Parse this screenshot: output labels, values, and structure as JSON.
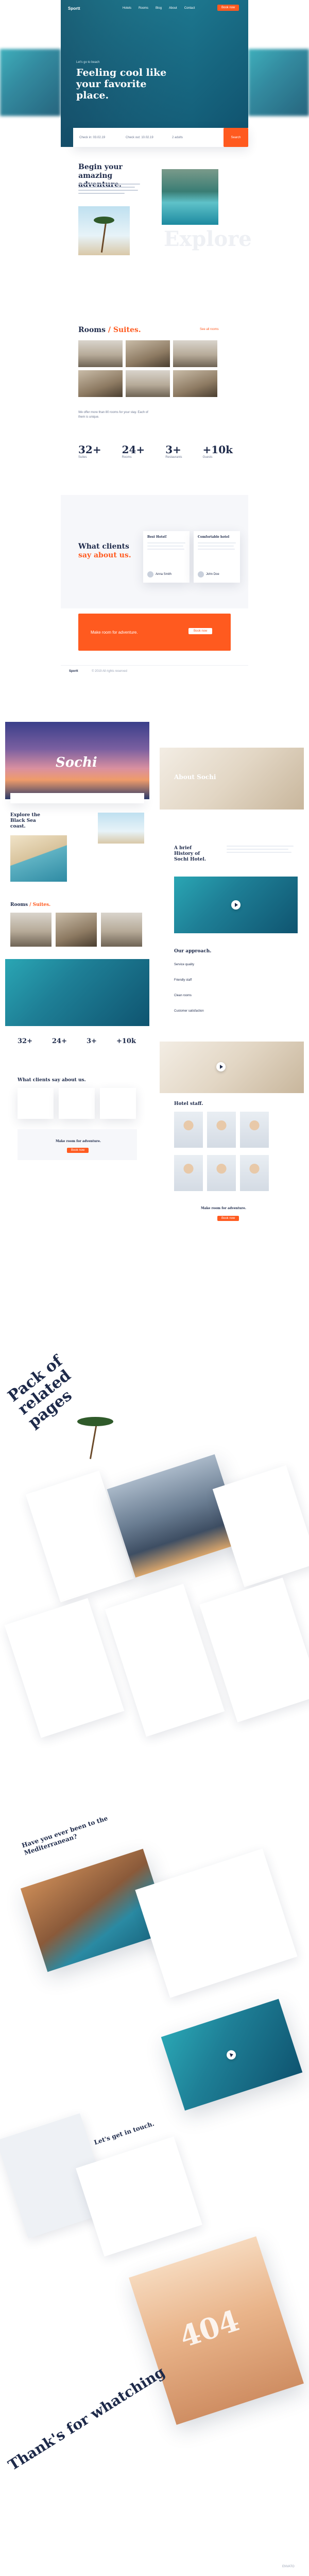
{
  "hero": {
    "logo": "Sportt",
    "nav": [
      "Hotels",
      "Rooms",
      "Blog",
      "About",
      "Contact"
    ],
    "cta": "Book now",
    "kicker": "Let's go to beach",
    "title": "Feeling cool like your favorite place.",
    "search": {
      "checkin": "Check in: 03.02.19",
      "checkout": "Check out: 10.02.19",
      "guests": "2 adults",
      "button": "Search"
    }
  },
  "adventure": {
    "title": "Begin your amazing adventure.",
    "watermark": "Explore"
  },
  "rooms": {
    "title_plain": "Rooms",
    "title_accent": "/ Suites.",
    "link": "See all rooms",
    "description": "We offer more than 80 rooms for your stay. Each of them is unique."
  },
  "stats": [
    {
      "value": "32+",
      "label": "Suites"
    },
    {
      "value": "24+",
      "label": "Rooms"
    },
    {
      "value": "3+",
      "label": "Restaurants"
    },
    {
      "value": "+10k",
      "label": "Guests"
    }
  ],
  "testimonials": {
    "title_plain": "What clients",
    "title_accent": "say about us.",
    "cards": [
      {
        "heading": "Best Hotel!",
        "name": "Anna Smith"
      },
      {
        "heading": "Comfortable hotel",
        "name": "John Doe"
      }
    ]
  },
  "promo": {
    "text": "Make room for adventure.",
    "button": "Book now"
  },
  "footer": {
    "logo": "Sportt",
    "copy": "© 2019 All rights reserved"
  },
  "page2": {
    "title": "Sochi",
    "explore_title": "Explore the Black Sea coast.",
    "rooms_title_plain": "Rooms",
    "rooms_title_accent": "/ Suites.",
    "stats": [
      "32+",
      "24+",
      "3+",
      "+10k"
    ],
    "clients_title": "What clients say about us.",
    "promo_text": "Make room for adventure.",
    "promo_button": "Book now"
  },
  "page3": {
    "hero_title": "About Sochi",
    "history_title": "A brief History of Sochi Hotel.",
    "approach_title": "Our approach.",
    "approach_items": [
      "Service quality",
      "Friendly staff",
      "Clean rooms",
      "Customer satisfaction"
    ],
    "staff_title": "Hotel staff.",
    "promo_text": "Make room for adventure.",
    "promo_button": "Book now"
  },
  "section_titles": {
    "pack": "Pack of related pages",
    "thanks": "Thank's for whatching"
  },
  "article": {
    "title": "Have you ever been to the Mediterranean?",
    "contact_title": "Let's get in touch.",
    "map_label": "Let's get in touch."
  },
  "error": {
    "code": "404"
  },
  "watermark": "ENVATO"
}
